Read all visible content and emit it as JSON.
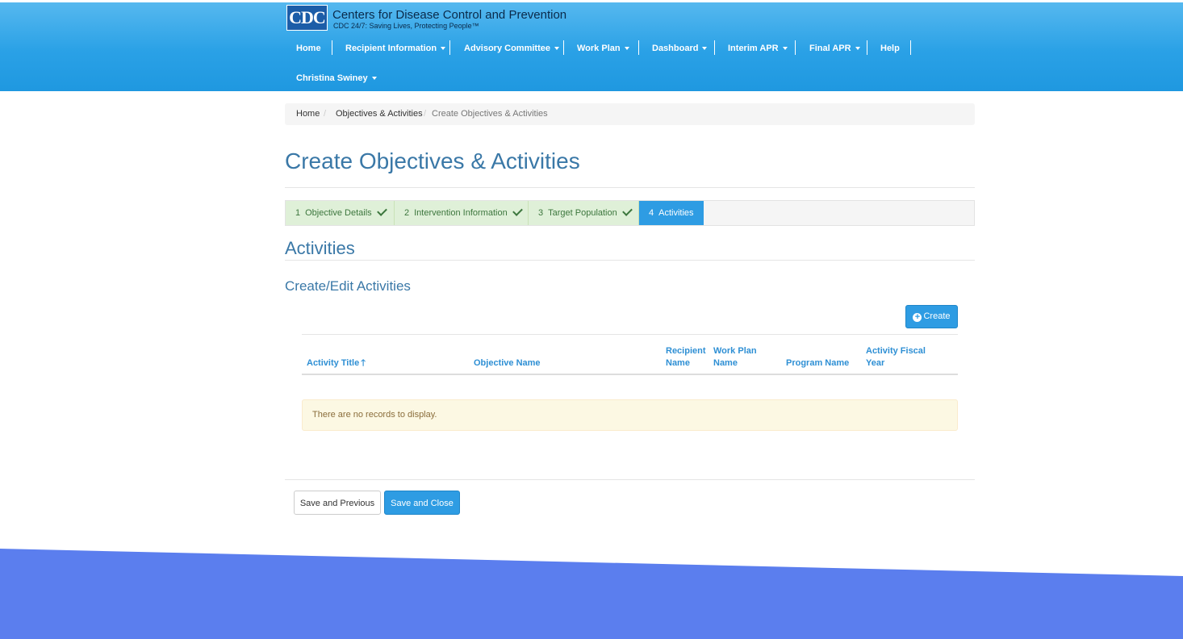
{
  "brand": {
    "logo_text": "CDC",
    "title": "Centers for Disease Control and Prevention",
    "tagline": "CDC 24/7: Saving Lives, Protecting People™"
  },
  "nav": {
    "items": [
      {
        "label": "Home",
        "dropdown": false
      },
      {
        "label": "Recipient Information",
        "dropdown": true
      },
      {
        "label": "Advisory Committee",
        "dropdown": true
      },
      {
        "label": "Work Plan",
        "dropdown": true
      },
      {
        "label": "Dashboard",
        "dropdown": true
      },
      {
        "label": "Interim APR",
        "dropdown": true
      },
      {
        "label": "Final APR",
        "dropdown": true
      },
      {
        "label": "Help",
        "dropdown": false
      }
    ],
    "user": "Christina Swiney"
  },
  "breadcrumb": {
    "items": [
      "Home",
      "Objectives & Activities",
      "Create Objectives & Activities"
    ],
    "separator": "/"
  },
  "page": {
    "title": "Create Objectives & Activities"
  },
  "steps": [
    {
      "number": "1",
      "label": "Objective Details",
      "status": "complete"
    },
    {
      "number": "2",
      "label": "Intervention Information",
      "status": "complete"
    },
    {
      "number": "3",
      "label": "Target Population",
      "status": "complete"
    },
    {
      "number": "4",
      "label": "Activities",
      "status": "active"
    }
  ],
  "activities": {
    "section_title": "Activities",
    "subsection_title": "Create/Edit Activities",
    "create_button": "Create",
    "columns": [
      {
        "label": "Activity Title",
        "sort": "ascending"
      },
      {
        "label": "Objective Name"
      },
      {
        "label": "Recipient Name"
      },
      {
        "label": "Work Plan Name"
      },
      {
        "label": "Program Name"
      },
      {
        "label": "Activity Fiscal Year"
      }
    ],
    "empty_message": "There are no records to display."
  },
  "footer_buttons": {
    "previous": "Save and Previous",
    "close": "Save and Close"
  },
  "colors": {
    "header_blue": "#2aa1e6",
    "title_blue": "#3a78a7",
    "primary_button": "#2e9ce3",
    "step_complete_bg": "#dff0d8",
    "alert_bg": "#fcf8e3",
    "footer_band": "#5b7eee"
  }
}
